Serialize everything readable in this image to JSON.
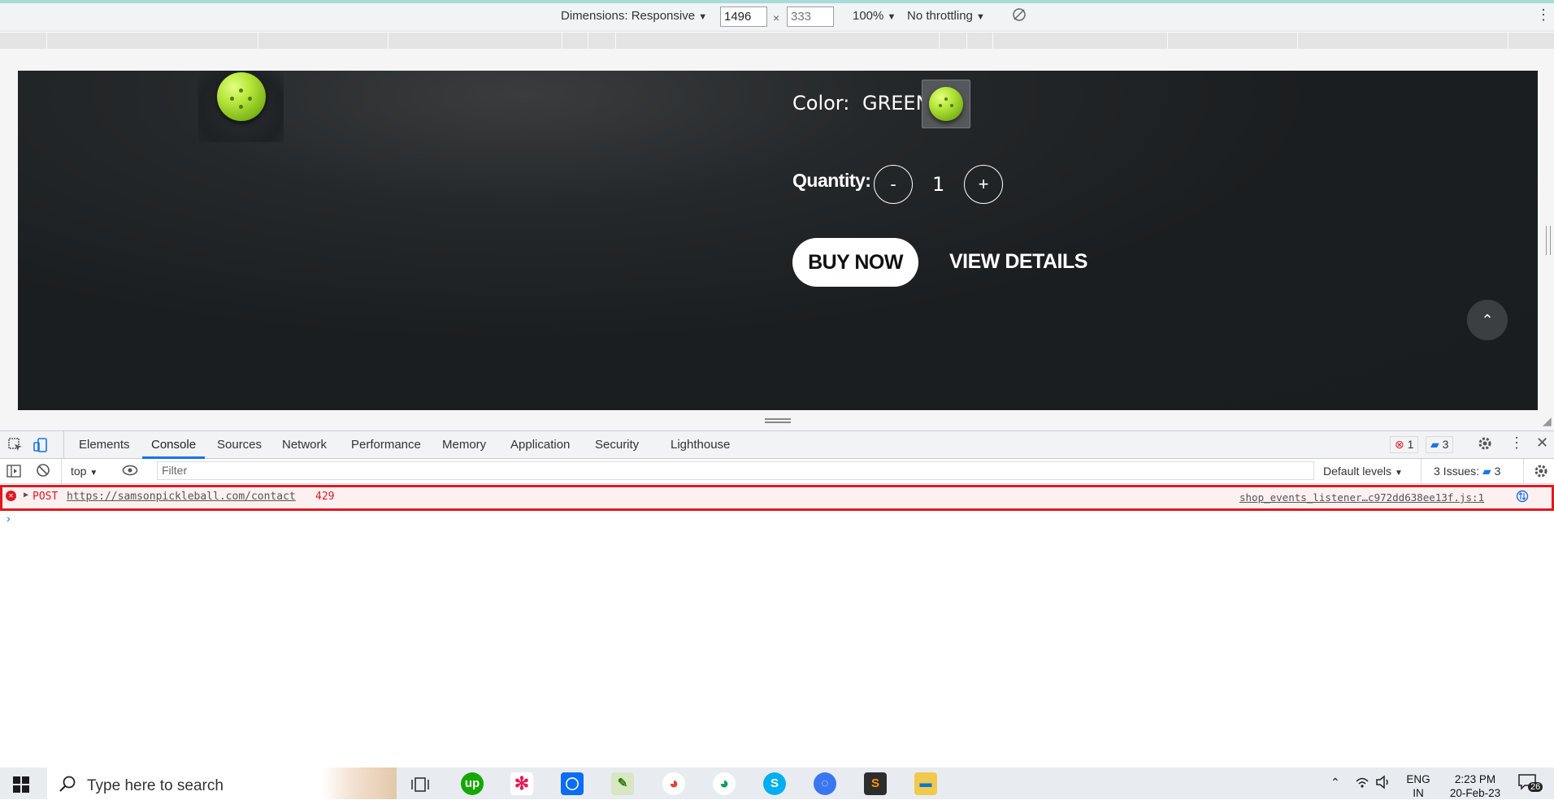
{
  "device_toolbar": {
    "dimensions_label": "Dimensions: Responsive",
    "width_value": "1496",
    "height_placeholder": "333",
    "times": "×",
    "zoom": "100%",
    "throttling": "No throttling"
  },
  "product": {
    "color_label": "Color:",
    "color_value": "GREEN",
    "quantity_label": "Quantity:",
    "minus": "-",
    "quantity": "1",
    "plus": "+",
    "buy_now": "BUY NOW",
    "view_details": "VIEW DETAILS"
  },
  "devtools": {
    "tabs": [
      "Elements",
      "Console",
      "Sources",
      "Network",
      "Performance",
      "Memory",
      "Application",
      "Security",
      "Lighthouse"
    ],
    "active_tab": "Console",
    "error_count": "1",
    "message_count": "3",
    "context": "top",
    "filter_placeholder": "Filter",
    "default_levels": "Default levels",
    "issues_label": "3 Issues:",
    "issues_count": "3"
  },
  "console": {
    "error": {
      "method": "POST",
      "url": "https://samsonpickleball.com/contact",
      "status": "429",
      "source": "shop_events_listener…c972dd638ee13f.js:1"
    },
    "prompt": "›"
  },
  "taskbar": {
    "search_placeholder": "Type here to search",
    "language_top": "ENG",
    "language_bottom": "IN",
    "time": "2:23 PM",
    "date": "20-Feb-23",
    "notification_count": "26"
  },
  "colors": {
    "page_bg": "#1a1d1f",
    "ball_green": "#9ed22c",
    "error_red": "#e0191d",
    "devtools_blue": "#1a73e8"
  }
}
